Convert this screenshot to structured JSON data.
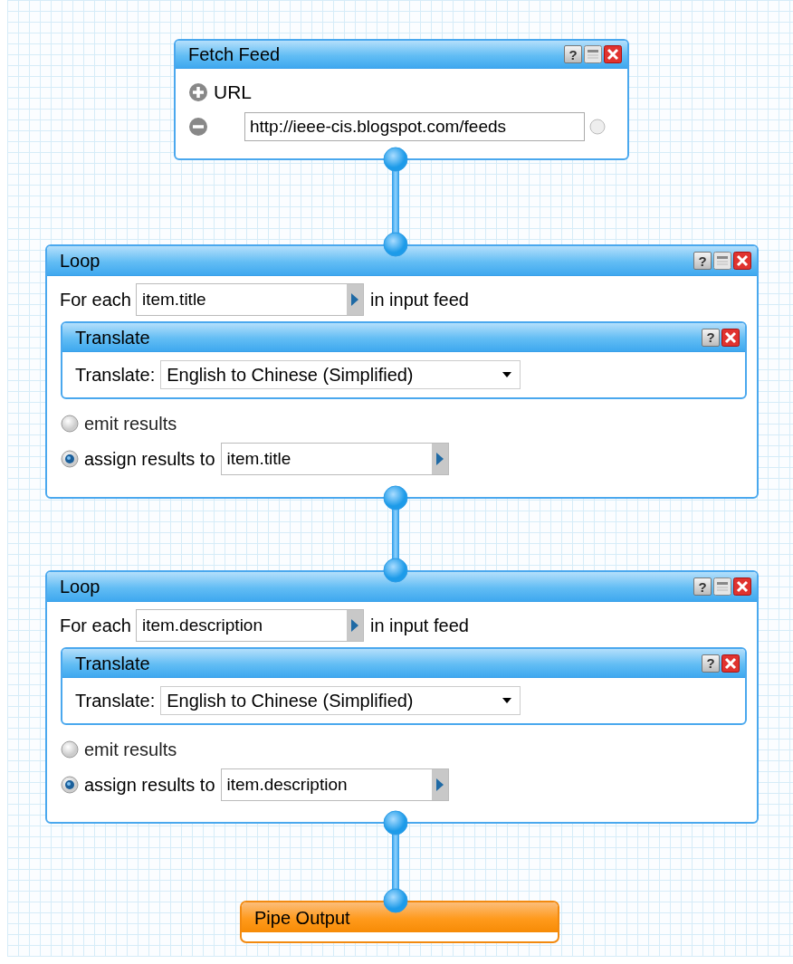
{
  "modules": [
    {
      "kind": "fetch",
      "title": "Fetch Feed",
      "header_buttons": [
        {
          "kind": "help",
          "label": "?"
        },
        {
          "kind": "minimize"
        },
        {
          "kind": "close"
        }
      ],
      "field_label": "URL",
      "url": "http://ieee-cis.blogspot.com/feeds"
    },
    {
      "kind": "loop",
      "title": "Loop",
      "header_buttons": [
        {
          "kind": "help",
          "label": "?"
        },
        {
          "kind": "minimize"
        },
        {
          "kind": "close"
        }
      ],
      "for_each_label": "For each",
      "field": "item.title",
      "suffix": "in input feed",
      "inner": {
        "title": "Translate",
        "header_buttons": [
          {
            "kind": "help",
            "label": "?"
          },
          {
            "kind": "close"
          }
        ],
        "label": "Translate:",
        "value": "English to Chinese (Simplified)"
      },
      "options": [
        {
          "label": "emit results",
          "selected": false
        },
        {
          "label": "assign results to",
          "selected": true,
          "field": "item.title"
        }
      ]
    },
    {
      "kind": "loop",
      "title": "Loop",
      "header_buttons": [
        {
          "kind": "help",
          "label": "?"
        },
        {
          "kind": "minimize"
        },
        {
          "kind": "close"
        }
      ],
      "for_each_label": "For each",
      "field": "item.description",
      "suffix": "in input feed",
      "inner": {
        "title": "Translate",
        "header_buttons": [
          {
            "kind": "help",
            "label": "?"
          },
          {
            "kind": "close"
          }
        ],
        "label": "Translate:",
        "value": "English to Chinese (Simplified)"
      },
      "options": [
        {
          "label": "emit results",
          "selected": false
        },
        {
          "label": "assign results to",
          "selected": true,
          "field": "item.description"
        }
      ]
    },
    {
      "kind": "output",
      "title": "Pipe Output"
    }
  ]
}
